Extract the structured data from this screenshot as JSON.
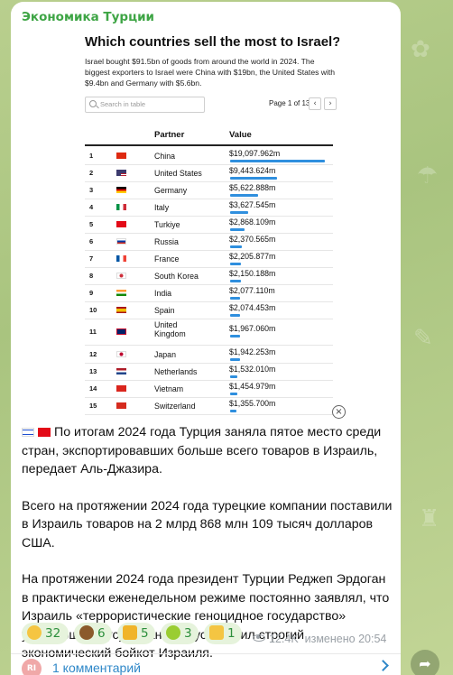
{
  "channel": {
    "name": "Экономика Турции"
  },
  "chart_data": {
    "type": "table",
    "title": "Which countries sell the most to Israel?",
    "subtitle": "Israel bought $91.5bn of goods from around the world in 2024. The biggest exporters to Israel were China with $19bn, the United States with $9.4bn and Germany with $5.6bn.",
    "search_placeholder": "Search in table",
    "pager": "Page 1 of 13",
    "columns": [
      "Partner",
      "Value"
    ],
    "rows": [
      {
        "rank": "1",
        "partner": "China",
        "value": "$19,097.962m",
        "v": 19097.962,
        "flag": "cn"
      },
      {
        "rank": "2",
        "partner": "United States",
        "value": "$9,443.624m",
        "v": 9443.624,
        "flag": "us"
      },
      {
        "rank": "3",
        "partner": "Germany",
        "value": "$5,622.888m",
        "v": 5622.888,
        "flag": "de"
      },
      {
        "rank": "4",
        "partner": "Italy",
        "value": "$3,627.545m",
        "v": 3627.545,
        "flag": "it"
      },
      {
        "rank": "5",
        "partner": "Turkiye",
        "value": "$2,868.109m",
        "v": 2868.109,
        "flag": "tr"
      },
      {
        "rank": "6",
        "partner": "Russia",
        "value": "$2,370.565m",
        "v": 2370.565,
        "flag": "ru"
      },
      {
        "rank": "7",
        "partner": "France",
        "value": "$2,205.877m",
        "v": 2205.877,
        "flag": "fr"
      },
      {
        "rank": "8",
        "partner": "South Korea",
        "value": "$2,150.188m",
        "v": 2150.188,
        "flag": "kr"
      },
      {
        "rank": "9",
        "partner": "India",
        "value": "$2,077.110m",
        "v": 2077.11,
        "flag": "in"
      },
      {
        "rank": "10",
        "partner": "Spain",
        "value": "$2,074.453m",
        "v": 2074.453,
        "flag": "es"
      },
      {
        "rank": "11",
        "partner": "United Kingdom",
        "value": "$1,967.060m",
        "v": 1967.06,
        "flag": "gb"
      },
      {
        "rank": "12",
        "partner": "Japan",
        "value": "$1,942.253m",
        "v": 1942.253,
        "flag": "jp"
      },
      {
        "rank": "13",
        "partner": "Netherlands",
        "value": "$1,532.010m",
        "v": 1532.01,
        "flag": "nl"
      },
      {
        "rank": "14",
        "partner": "Vietnam",
        "value": "$1,454.979m",
        "v": 1454.979,
        "flag": "vn"
      },
      {
        "rank": "15",
        "partner": "Switzerland",
        "value": "$1,355.700m",
        "v": 1355.7,
        "flag": "ch"
      }
    ]
  },
  "post": {
    "paragraph1": "По итогам 2024 года Турция заняла пятое место среди стран, экспортировавших больше всего товаров в Израиль, передает Аль-Джазира.",
    "paragraph2": "Всего на протяжении 2024 года турецкие компании поставили в Израиль товаров на 2 млрд 868 млн 109 тысяч долларов США.",
    "paragraph3": "На протяжении 2024 года президент Турции Реджеп Эрдоган в практически еженедельном режиме постоянно заявлял, что Израиль «террористические геноцидное государство» угнетающее мусульман и он установил строгий экономический бойкот Израиля."
  },
  "reactions": [
    {
      "icon": "grinning-face-icon",
      "count": "32",
      "color": "#f5c542"
    },
    {
      "icon": "poop-icon",
      "count": "6",
      "color": "#8b5a2b"
    },
    {
      "icon": "trophy-icon",
      "count": "5",
      "color": "#f0b429"
    },
    {
      "icon": "nauseated-face-icon",
      "count": "3",
      "color": "#9acd32"
    },
    {
      "icon": "thumbs-down-icon",
      "count": "1",
      "color": "#f4c542"
    }
  ],
  "meta": {
    "views": "12.4K",
    "edited_label": "изменено",
    "time": "20:54"
  },
  "comments": {
    "avatar_initials": "RI",
    "label": "1 комментарий"
  }
}
